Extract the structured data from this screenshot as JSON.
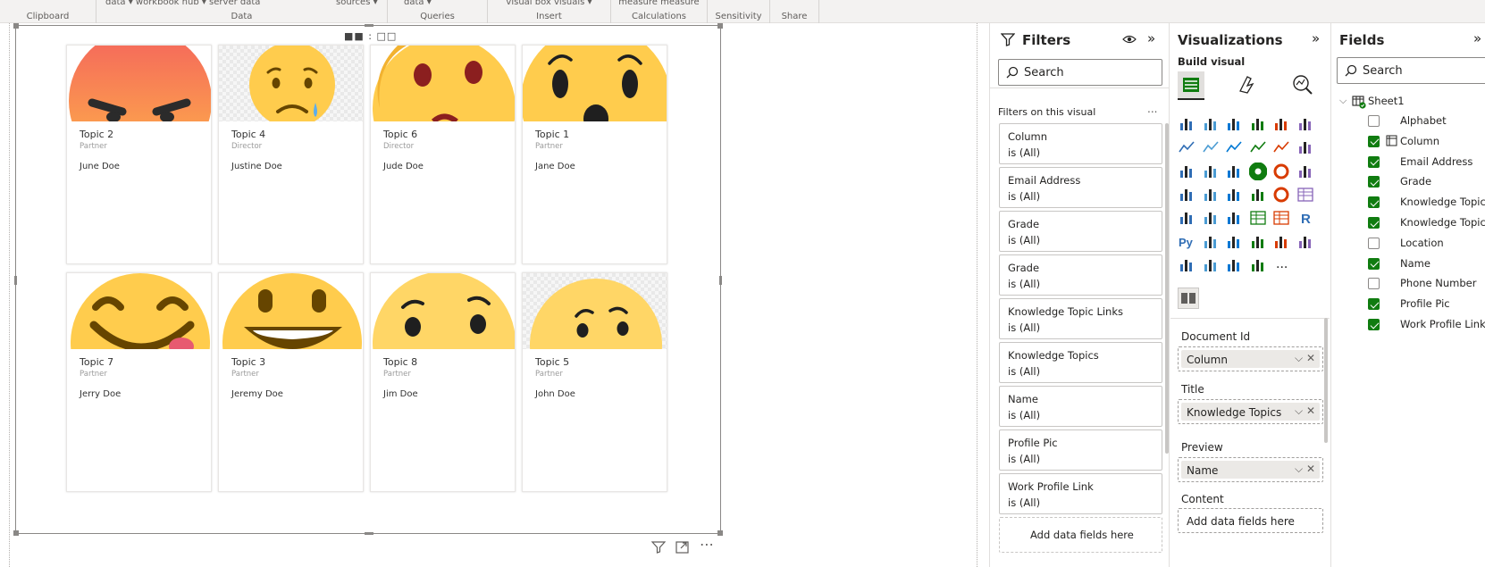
{
  "ribbon": {
    "top_labels": {
      "clipboard": "",
      "data": "data ▾   workbook  hub ▾   server   data",
      "sources": "sources ▾",
      "queries": "data ▾",
      "insert": "visual    box    visuals ▾",
      "calculations": "measure  measure"
    },
    "groups": {
      "clipboard": "Clipboard",
      "data": "Data",
      "queries": "Queries",
      "insert": "Insert",
      "calculations": "Calculations",
      "sensitivity": "Sensitivity",
      "share": "Share"
    }
  },
  "canvas": {
    "pager": "■■ : □□",
    "cards": [
      {
        "title": "Topic 2",
        "role": "Partner",
        "person": "June Doe",
        "emoji": "angry-face"
      },
      {
        "title": "Topic 4",
        "role": "Director",
        "person": "Justine Doe",
        "emoji": "sad-face"
      },
      {
        "title": "Topic 6",
        "role": "Director",
        "person": "Jude Doe",
        "emoji": "silly-face"
      },
      {
        "title": "Topic 1",
        "role": "Partner",
        "person": "Jane Doe",
        "emoji": "surprised-face"
      },
      {
        "title": "Topic 7",
        "role": "Partner",
        "person": "Jerry Doe",
        "emoji": "happy-face"
      },
      {
        "title": "Topic 3",
        "role": "Partner",
        "person": "Jeremy Doe",
        "emoji": "grin-face"
      },
      {
        "title": "Topic 8",
        "role": "Partner",
        "person": "Jim Doe",
        "emoji": "skeptical-face"
      },
      {
        "title": "Topic 5",
        "role": "Partner",
        "person": "John Doe",
        "emoji": "skeptical-face"
      }
    ]
  },
  "filters": {
    "title": "Filters",
    "search_placeholder": "Search",
    "section_title": "Filters on this visual",
    "more": "...",
    "cards": [
      {
        "name": "Column",
        "value": "is (All)"
      },
      {
        "name": "Email Address",
        "value": "is (All)"
      },
      {
        "name": "Grade",
        "value": "is (All)"
      },
      {
        "name": "Grade",
        "value": "is (All)"
      },
      {
        "name": "Knowledge Topic Links",
        "value": "is (All)"
      },
      {
        "name": "Knowledge Topics",
        "value": "is (All)"
      },
      {
        "name": "Name",
        "value": "is (All)"
      },
      {
        "name": "Profile Pic",
        "value": "is (All)"
      },
      {
        "name": "Work Profile Link",
        "value": "is (All)"
      }
    ],
    "add_fields": "Add data fields here"
  },
  "visualizations": {
    "title": "Visualizations",
    "build_visual": "Build visual",
    "more": "...",
    "wells": [
      {
        "label": "Document Id",
        "value": "Column"
      },
      {
        "label": "Title",
        "value": "Knowledge Topics"
      },
      {
        "label": "Preview",
        "value": "Name"
      },
      {
        "label": "Content",
        "value": "Add data fields here"
      }
    ]
  },
  "fields": {
    "title": "Fields",
    "search_placeholder": "Search",
    "table": "Sheet1",
    "items": [
      {
        "name": "Alphabet",
        "checked": false
      },
      {
        "name": "Column",
        "checked": true
      },
      {
        "name": "Email Address",
        "checked": true
      },
      {
        "name": "Grade",
        "checked": true
      },
      {
        "name": "Knowledge Topic...",
        "checked": true
      },
      {
        "name": "Knowledge Topics",
        "checked": true
      },
      {
        "name": "Location",
        "checked": false
      },
      {
        "name": "Name",
        "checked": true
      },
      {
        "name": "Phone Number",
        "checked": false
      },
      {
        "name": "Profile Pic",
        "checked": true
      },
      {
        "name": "Work Profile Link",
        "checked": true
      }
    ]
  },
  "colors": {
    "accent_green": "#107c10",
    "emoji_yellow": "#ffcc4d",
    "angry_red": "#f46a5a"
  }
}
